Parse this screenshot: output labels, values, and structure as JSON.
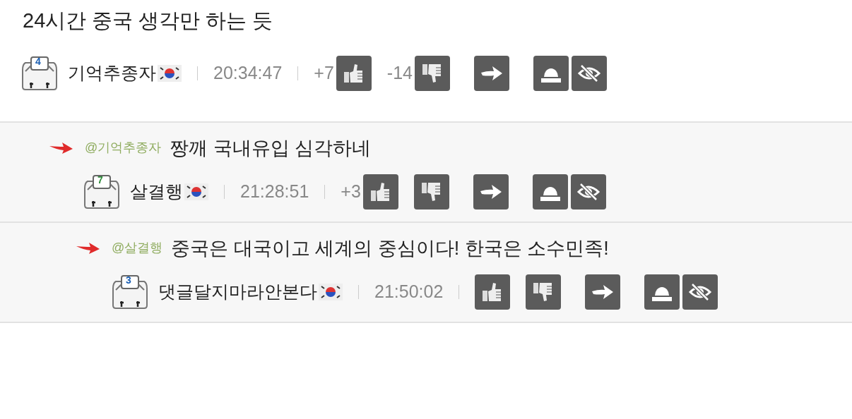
{
  "post": {
    "title": "24시간 중국 생각만 하는 듯",
    "meta": {
      "rank": "4",
      "author": "기억추종자",
      "time": "20:34:47",
      "up_count": "+7",
      "down_count": "-14"
    },
    "replies": [
      {
        "mention": "@기억추종자",
        "text": "짱깨 국내유입 심각하네",
        "meta": {
          "rank": "7",
          "author": "살결행",
          "time": "21:28:51",
          "up_count": "+3"
        },
        "children": [
          {
            "mention": "@살결행",
            "text": "중국은 대국이고 세계의 중심이다! 한국은 소수민족!",
            "meta": {
              "rank": "3",
              "author": "댓글달지마라안본다",
              "time": "21:50:02"
            }
          }
        ]
      }
    ]
  }
}
